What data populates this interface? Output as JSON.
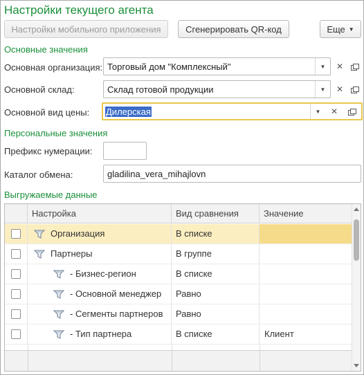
{
  "window_title": "Настройки текущего агента",
  "toolbar": {
    "mobile_settings_label": "Настройки мобильного приложения",
    "qr_label": "Сгенерировать QR-код",
    "more_label": "Еще"
  },
  "main_section": {
    "title": "Основные значения",
    "org_label": "Основная организация:",
    "org_value": "Торговый дом \"Комплексный\"",
    "warehouse_label": "Основной склад:",
    "warehouse_value": "Склад готовой продукции",
    "price_label": "Основной вид цены:",
    "price_value": "Дилерская"
  },
  "personal_section": {
    "title": "Персональные значения",
    "prefix_label": "Префикс нумерации:",
    "prefix_value": "",
    "catalog_label": "Каталог обмена:",
    "catalog_value": "gladilina_vera_mihajlovn"
  },
  "export_section": {
    "title": "Выгружаемые данные",
    "columns": [
      "Настройка",
      "Вид сравнения",
      "Значение"
    ],
    "rows": [
      {
        "name": "Организация",
        "comparison": "В списке",
        "value": "",
        "selected": true
      },
      {
        "name": "Партнеры",
        "comparison": "В группе",
        "value": ""
      },
      {
        "name": "- Бизнес-регион",
        "comparison": "В списке",
        "value": ""
      },
      {
        "name": "- Основной менеджер",
        "comparison": "Равно",
        "value": ""
      },
      {
        "name": "- Сегменты партнеров",
        "comparison": "Равно",
        "value": ""
      },
      {
        "name": "- Тип партнера",
        "comparison": "В списке",
        "value": "Клиент"
      }
    ]
  },
  "icons": {
    "dropdown": "chevron-down-icon",
    "clear": "clear-icon",
    "open": "open-icon",
    "filter": "filter-icon"
  },
  "colors": {
    "section_title": "#1a8f3a",
    "selection": "#fbeec0",
    "focus": "#e8c84a",
    "text_selection": "#3a6cc9"
  }
}
